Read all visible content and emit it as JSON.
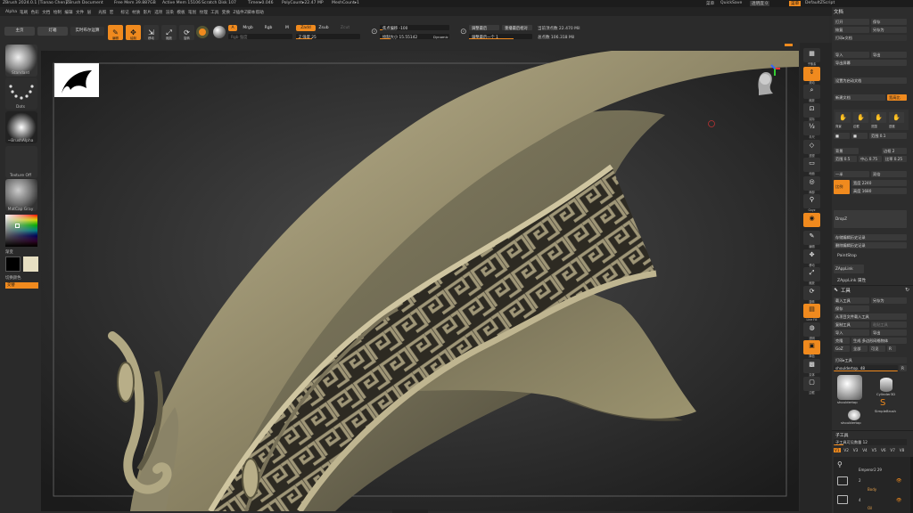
{
  "titlebar": {
    "app": "ZBrush 2024.0.1 [Tianao Chen]",
    "doc": "ZBrush Document",
    "free_mem": "Free Mem 39.887GB",
    "active_mem": "Active Mem 15106",
    "scratch": "Scratch Disk 107",
    "timer": "Timer▸0.046",
    "poly": "PolyCount▸22.47 MP",
    "mesh": "MeshCount▸1",
    "right": [
      "菜单",
      "QuickSave",
      "透明度 0",
      "菜单",
      "DefaultZScript"
    ]
  },
  "menubar": [
    "Alpha",
    "笔刷",
    "色彩",
    "文档",
    "绘制",
    "编辑",
    "文件",
    "层",
    "光照",
    "宏",
    "标记",
    "材质",
    "影片",
    "选项",
    "渲染",
    "模板",
    "笔划",
    "纹理",
    "工具",
    "变换",
    "Z插件",
    "Z脚本",
    "帮助"
  ],
  "toolbar": {
    "home": "主页",
    "lightbox": "灯箱",
    "live_boolean": "实时布尔运算",
    "icon_buttons": [
      "编辑",
      "绘制",
      "移动",
      "缩放",
      "旋转"
    ],
    "a_label": "A",
    "mrgb": "Mrgb",
    "rgb": "Rgb",
    "m": "M",
    "zadd": "Zadd",
    "zsub": "Zsub",
    "zcut": "Zcut",
    "rgb_intensity": "Rgb 强度",
    "z_intensity": "Z 强度 25",
    "focal_shift": "焦点偏移 -100",
    "draw_size": "绘制大小 15.55142",
    "dynamic": "Dynamic",
    "adjust_last": "调整最后",
    "adjust_last_val": "调整最后一个 1",
    "replay_last": "重播最后",
    "replay_last_rel": "重播最后相对",
    "active_points": "当前顶点数 22.470 Mil",
    "total_points": "总点数 106.318 Mil"
  },
  "leftshelf": {
    "brush": "Standard",
    "stroke": "Dots",
    "alpha": "~BrushAlpha",
    "texture": "Texture Off",
    "material": "MatCap Gray",
    "gradient": "渐变",
    "switch_color": "切换颜色",
    "alternate": "交替"
  },
  "rightshelf": [
    "子像素",
    "滚动",
    "缩放",
    "实际",
    "半尺",
    "透视",
    "地面",
    "局部",
    "Gxyz",
    "",
    "编辑",
    "移动",
    "缩放",
    "旋转",
    "Line Fill",
    "透明",
    "降色",
    "实体",
    "边框"
  ],
  "rightpanel": {
    "doc_title": "文档",
    "open": "打开",
    "save": "保存",
    "revert": "恢复",
    "save_as": "另存为",
    "open_doc": "打印▸文档",
    "import": "导入",
    "export": "导出",
    "export_screen": "导出屏幕",
    "set_default": "设置为启动文档",
    "new_doc": "新建文档",
    "wsize": "宽高比",
    "row1": [
      "背景",
      "边框",
      "范围",
      "进度"
    ],
    "range": "范围 0.1",
    "back": "背景",
    "border": "边框 2",
    "range2": "范围 0.5",
    "center": "中心 0.75",
    "rate": "比率 0.25",
    "half": "一半",
    "double": "双倍",
    "pro": "比例",
    "width": "宽度 2240",
    "height": "高度 1680",
    "dropz": "DropZ",
    "store_mode": "存储编辑历史记录",
    "delete_undo": "删除编辑历史记录",
    "paintstop": "PaintStop",
    "zapplink": "ZAppLink",
    "zapplink_prop": "ZAppLink 属性",
    "tool_title": "工具",
    "load_tool": "载入工具",
    "save_as_tool": "另存为",
    "save_tool": "保存",
    "from_proj": "从项目文件载入工具",
    "copy_tool": "复制工具",
    "paste_tool": "粘贴工具",
    "import_t": "导入",
    "export_t": "导出",
    "clone": "克隆",
    "make_polymesh": "生成 多边形网格物体",
    "goz": "GoZ",
    "all": "全部",
    "visible": "可见",
    "r_label": "R",
    "print_tool": "打印▸工具",
    "current_tool": "shouldertop. 48",
    "thumb1": "shouldertop",
    "thumb2": "Cylinder3D",
    "thumb3": "SimpleBrush",
    "thumb4": "shouldertop",
    "subtool_title": "子工具",
    "subtool_count": "子工具可见数量 12",
    "v_labels": [
      "V1",
      "V2",
      "V3",
      "V4",
      "V5",
      "V6",
      "V7",
      "V8"
    ],
    "st1": "Emperor2 29",
    "st2": "2",
    "st2_name": "Body",
    "st3": "4",
    "st3_name": "Oil"
  },
  "colors": {
    "accent": "#f08a1e",
    "bg": "#2a2a2a",
    "metal": "#a39a7a"
  }
}
